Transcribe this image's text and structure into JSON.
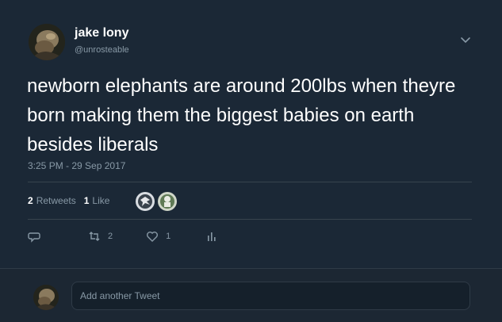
{
  "tweet": {
    "author_name": "jake lony",
    "author_handle": "@unrosteable",
    "text": "newborn elephants are around 200lbs when theyre born making them the biggest babies on earth besides liberals",
    "timestamp": "3:25 PM - 29 Sep 2017",
    "stats": {
      "retweets_count": "2",
      "retweets_label": "Retweets",
      "likes_count": "1",
      "likes_label": "Like"
    },
    "actions": {
      "reply_icon": "reply-icon",
      "retweet_icon": "retweet-icon",
      "retweet_count": "2",
      "like_icon": "heart-icon",
      "like_count": "1",
      "analytics_icon": "analytics-icon"
    }
  },
  "reply": {
    "placeholder": "Add another Tweet"
  },
  "colors": {
    "background": "#1b2836",
    "text_primary": "#ffffff",
    "text_secondary": "#8899a6",
    "divider": "#38444d"
  }
}
